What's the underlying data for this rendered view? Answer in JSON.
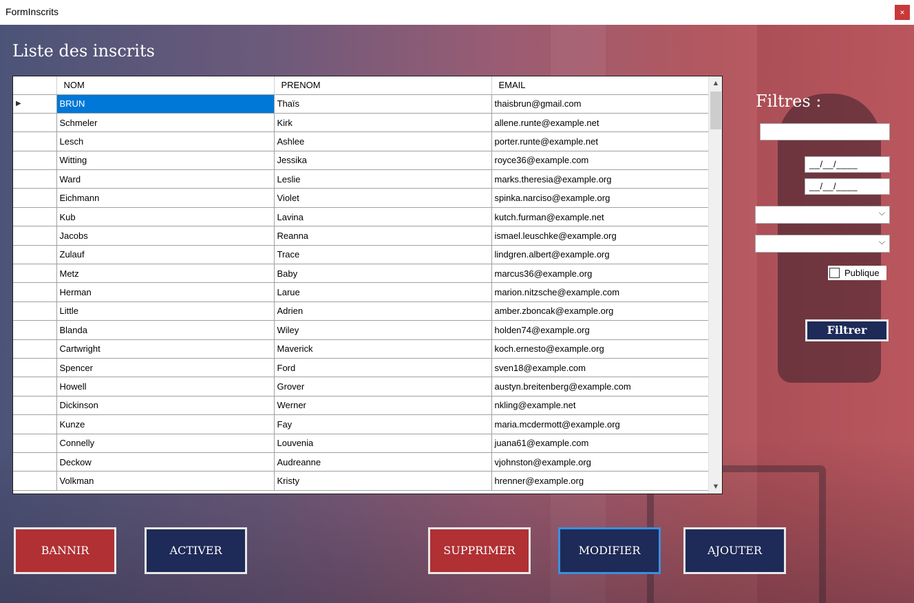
{
  "window": {
    "title": "FormInscrits",
    "close_label": "×"
  },
  "page": {
    "title": "Liste des inscrits"
  },
  "grid": {
    "columns": [
      "NOM",
      "PRENOM",
      "EMAIL"
    ],
    "row_indicator": "▶",
    "rows": [
      {
        "nom": "BRUN",
        "prenom": "Thaïs",
        "email": "thaisbrun@gmail.com"
      },
      {
        "nom": "Schmeler",
        "prenom": "Kirk",
        "email": "allene.runte@example.net"
      },
      {
        "nom": "Lesch",
        "prenom": "Ashlee",
        "email": "porter.runte@example.net"
      },
      {
        "nom": "Witting",
        "prenom": "Jessika",
        "email": "royce36@example.com"
      },
      {
        "nom": "Ward",
        "prenom": "Leslie",
        "email": "marks.theresia@example.org"
      },
      {
        "nom": "Eichmann",
        "prenom": "Violet",
        "email": "spinka.narciso@example.org"
      },
      {
        "nom": "Kub",
        "prenom": "Lavina",
        "email": "kutch.furman@example.net"
      },
      {
        "nom": "Jacobs",
        "prenom": "Reanna",
        "email": "ismael.leuschke@example.org"
      },
      {
        "nom": "Zulauf",
        "prenom": "Trace",
        "email": "lindgren.albert@example.org"
      },
      {
        "nom": "Metz",
        "prenom": "Baby",
        "email": "marcus36@example.org"
      },
      {
        "nom": "Herman",
        "prenom": "Larue",
        "email": "marion.nitzsche@example.com"
      },
      {
        "nom": "Little",
        "prenom": "Adrien",
        "email": "amber.zboncak@example.org"
      },
      {
        "nom": "Blanda",
        "prenom": "Wiley",
        "email": "holden74@example.org"
      },
      {
        "nom": "Cartwright",
        "prenom": "Maverick",
        "email": "koch.ernesto@example.org"
      },
      {
        "nom": "Spencer",
        "prenom": "Ford",
        "email": "sven18@example.com"
      },
      {
        "nom": "Howell",
        "prenom": "Grover",
        "email": "austyn.breitenberg@example.com"
      },
      {
        "nom": "Dickinson",
        "prenom": "Werner",
        "email": "nkling@example.net"
      },
      {
        "nom": "Kunze",
        "prenom": "Fay",
        "email": "maria.mcdermott@example.org"
      },
      {
        "nom": "Connelly",
        "prenom": "Louvenia",
        "email": "juana61@example.com"
      },
      {
        "nom": "Deckow",
        "prenom": "Audreanne",
        "email": "vjohnston@example.org"
      },
      {
        "nom": "Volkman",
        "prenom": "Kristy",
        "email": "hrenner@example.org"
      }
    ]
  },
  "filters": {
    "title": "Filtres :",
    "search_value": "",
    "date_from": "__/__/____",
    "date_to": "__/__/____",
    "select1_value": "",
    "select2_value": "",
    "publique_label": "Publique",
    "publique_checked": false,
    "filter_button": "Filtrer"
  },
  "actions": {
    "bannir": "BANNIR",
    "activer": "ACTIVER",
    "supprimer": "SUPPRIMER",
    "modifier": "MODIFIER",
    "ajouter": "AJOUTER"
  },
  "colors": {
    "navy": "#1e2a57",
    "red": "#b03033",
    "selection": "#0078d7"
  }
}
